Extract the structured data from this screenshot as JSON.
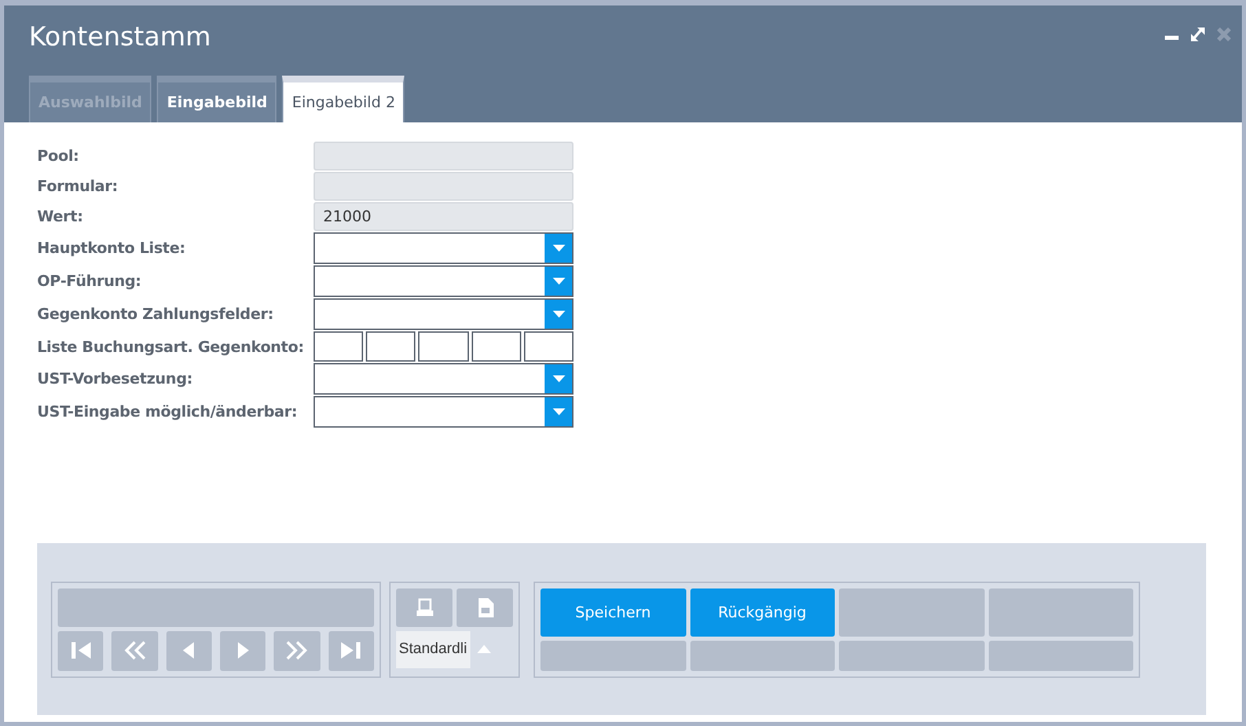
{
  "window": {
    "title": "Kontenstamm"
  },
  "tabs": [
    {
      "label": "Auswahlbild",
      "selected": false,
      "disabled": true
    },
    {
      "label": "Eingabebild",
      "selected": false,
      "disabled": false
    },
    {
      "label": "Eingabebild 2",
      "selected": true,
      "disabled": false
    }
  ],
  "fields": [
    {
      "label": "Pool:",
      "kind": "readonly"
    },
    {
      "label": "Formular:",
      "kind": "readonly"
    },
    {
      "label": "Wert:",
      "kind": "readonly",
      "value": "21000"
    },
    {
      "label": "Hauptkonto Liste:",
      "kind": "select"
    },
    {
      "label": "OP-Führung:",
      "kind": "select"
    },
    {
      "label": "Gegenkonto Zahlungsfelder:",
      "kind": "select"
    },
    {
      "label": "Liste Buchungsart. Gegenkonto:",
      "kind": "multi"
    },
    {
      "label": "UST-Vorbesetzung:",
      "kind": "select"
    },
    {
      "label": "UST-Eingabe möglich/änderbar:",
      "kind": "select"
    }
  ],
  "navigation": {
    "enabled": false
  },
  "print": {
    "layout_value": "Standardli"
  },
  "actions": [
    {
      "label": "Speichern",
      "enabled": true
    },
    {
      "label": "Rückgängig",
      "enabled": true
    },
    {
      "enabled": false
    },
    {
      "enabled": false
    },
    {
      "enabled": false
    },
    {
      "enabled": false
    },
    {
      "enabled": false
    },
    {
      "enabled": false
    }
  ]
}
